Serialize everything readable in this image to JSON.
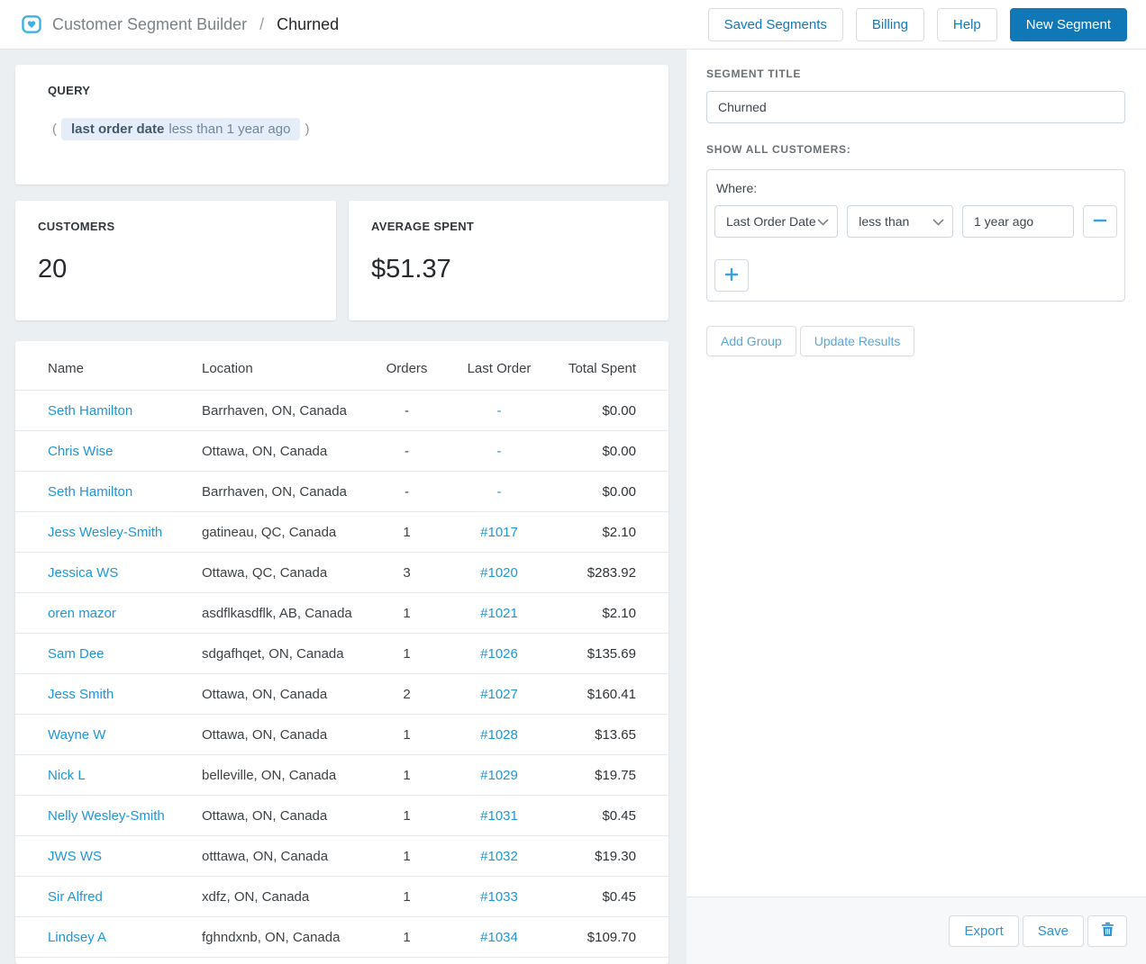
{
  "header": {
    "app_title": "Customer Segment Builder",
    "breadcrumb_separator": "/",
    "page_title": "Churned",
    "saved_segments_label": "Saved Segments",
    "billing_label": "Billing",
    "help_label": "Help",
    "new_segment_label": "New Segment"
  },
  "query": {
    "label": "QUERY",
    "open_paren": "(",
    "close_paren": ")",
    "field": "last order date",
    "condition": "less than 1 year ago"
  },
  "stats": {
    "customers_label": "CUSTOMERS",
    "customers_value": "20",
    "average_spent_label": "AVERAGE SPENT",
    "average_spent_value": "$51.37"
  },
  "table": {
    "columns": {
      "name": "Name",
      "location": "Location",
      "orders": "Orders",
      "last_order": "Last Order",
      "total_spent": "Total Spent"
    },
    "rows": [
      {
        "name": "Seth Hamilton",
        "location": "Barrhaven, ON, Canada",
        "orders": "-",
        "last_order": "-",
        "total": "$0.00"
      },
      {
        "name": "Chris Wise",
        "location": "Ottawa, ON, Canada",
        "orders": "-",
        "last_order": "-",
        "total": "$0.00"
      },
      {
        "name": "Seth Hamilton",
        "location": "Barrhaven, ON, Canada",
        "orders": "-",
        "last_order": "-",
        "total": "$0.00"
      },
      {
        "name": "Jess Wesley-Smith",
        "location": "gatineau, QC, Canada",
        "orders": "1",
        "last_order": "#1017",
        "total": "$2.10"
      },
      {
        "name": "Jessica WS",
        "location": "Ottawa, QC, Canada",
        "orders": "3",
        "last_order": "#1020",
        "total": "$283.92"
      },
      {
        "name": "oren mazor",
        "location": "asdflkasdflk, AB, Canada",
        "orders": "1",
        "last_order": "#1021",
        "total": "$2.10"
      },
      {
        "name": "Sam Dee",
        "location": "sdgafhqet, ON, Canada",
        "orders": "1",
        "last_order": "#1026",
        "total": "$135.69"
      },
      {
        "name": "Jess Smith",
        "location": "Ottawa, ON, Canada",
        "orders": "2",
        "last_order": "#1027",
        "total": "$160.41"
      },
      {
        "name": "Wayne W",
        "location": "Ottawa, ON, Canada",
        "orders": "1",
        "last_order": "#1028",
        "total": "$13.65"
      },
      {
        "name": "Nick L",
        "location": "belleville, ON, Canada",
        "orders": "1",
        "last_order": "#1029",
        "total": "$19.75"
      },
      {
        "name": "Nelly Wesley-Smith",
        "location": "Ottawa, ON, Canada",
        "orders": "1",
        "last_order": "#1031",
        "total": "$0.45"
      },
      {
        "name": "JWS WS",
        "location": "otttawa, ON, Canada",
        "orders": "1",
        "last_order": "#1032",
        "total": "$19.30"
      },
      {
        "name": "Sir Alfred",
        "location": "xdfz, ON, Canada",
        "orders": "1",
        "last_order": "#1033",
        "total": "$0.45"
      },
      {
        "name": "Lindsey A",
        "location": "fghndxnb, ON, Canada",
        "orders": "1",
        "last_order": "#1034",
        "total": "$109.70"
      }
    ]
  },
  "sidebar": {
    "segment_title_label": "SEGMENT TITLE",
    "segment_title_value": "Churned",
    "show_all_label": "SHOW ALL CUSTOMERS:",
    "where_label": "Where:",
    "filter_field": "Last Order Date",
    "filter_operator": "less than",
    "filter_value": "1 year ago",
    "add_group_label": "Add Group",
    "update_results_label": "Update Results",
    "export_label": "Export",
    "save_label": "Save"
  },
  "colors": {
    "primary_blue": "#1178b8",
    "link_blue": "#1f96d7",
    "light_blue_icon": "#3ba0dc",
    "logo_blue": "#3fb0e0",
    "page_background": "#eceff1",
    "pill_background": "#e4edf8",
    "footer_background": "#f7f8f9"
  }
}
